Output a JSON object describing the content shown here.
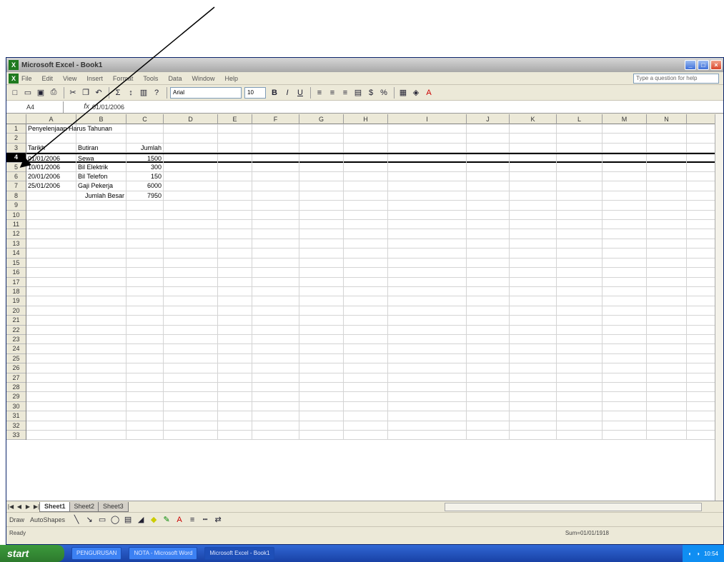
{
  "window": {
    "title": "Microsoft Excel - Book1",
    "app_icon": "excel-icon"
  },
  "menu": {
    "items": [
      "File",
      "Edit",
      "View",
      "Insert",
      "Format",
      "Tools",
      "Data",
      "Window",
      "Help"
    ],
    "help_placeholder": "Type a question for help"
  },
  "toolbar": {
    "font": "Arial",
    "size": "10"
  },
  "formula": {
    "namebox": "A4",
    "fx": "fx",
    "content": "01/01/2006"
  },
  "columns": [
    "A",
    "B",
    "C",
    "D",
    "E",
    "F",
    "G",
    "H",
    "I",
    "J",
    "K",
    "L",
    "M",
    "N"
  ],
  "rows": [
    {
      "n": "1",
      "A": "Penyelenjaan Harus Tahunan",
      "B": "",
      "C": ""
    },
    {
      "n": "2",
      "A": "",
      "B": "",
      "C": ""
    },
    {
      "n": "3",
      "A": "Tarikh",
      "B": "Butiran",
      "C": "Jumlah"
    },
    {
      "n": "4",
      "A": "01/01/2006",
      "B": "Sewa",
      "C": "1500"
    },
    {
      "n": "5",
      "A": "10/01/2006",
      "B": "Bil Elektrik",
      "C": "300"
    },
    {
      "n": "6",
      "A": "20/01/2006",
      "B": "Bil Telefon",
      "C": "150"
    },
    {
      "n": "7",
      "A": "25/01/2006",
      "B": "Gaji Pekerja",
      "C": "6000"
    },
    {
      "n": "8",
      "A": "",
      "B": "Jumlah Besar",
      "C": "7950"
    },
    {
      "n": "9"
    },
    {
      "n": "10"
    },
    {
      "n": "11"
    },
    {
      "n": "12"
    },
    {
      "n": "13"
    },
    {
      "n": "14"
    },
    {
      "n": "15"
    },
    {
      "n": "16"
    },
    {
      "n": "17"
    },
    {
      "n": "18"
    },
    {
      "n": "19"
    },
    {
      "n": "20"
    },
    {
      "n": "21"
    },
    {
      "n": "22"
    },
    {
      "n": "23"
    },
    {
      "n": "24"
    },
    {
      "n": "25"
    },
    {
      "n": "26"
    },
    {
      "n": "27"
    },
    {
      "n": "28"
    },
    {
      "n": "29"
    },
    {
      "n": "30"
    },
    {
      "n": "31"
    },
    {
      "n": "32"
    },
    {
      "n": "33"
    }
  ],
  "selected_row": "4",
  "sheets": [
    "Sheet1",
    "Sheet2",
    "Sheet3"
  ],
  "active_sheet": "Sheet1",
  "drawbar": {
    "draw": "Draw",
    "autoshapes": "AutoShapes"
  },
  "status": {
    "ready": "Ready",
    "sum": "Sum=01/01/1918"
  },
  "taskbar": {
    "start": "start",
    "tasks": [
      "PENGURUSAN",
      "NOTA - Microsoft Word",
      "Microsoft Excel - Book1"
    ],
    "active_task": 2,
    "clock": "10:54"
  }
}
